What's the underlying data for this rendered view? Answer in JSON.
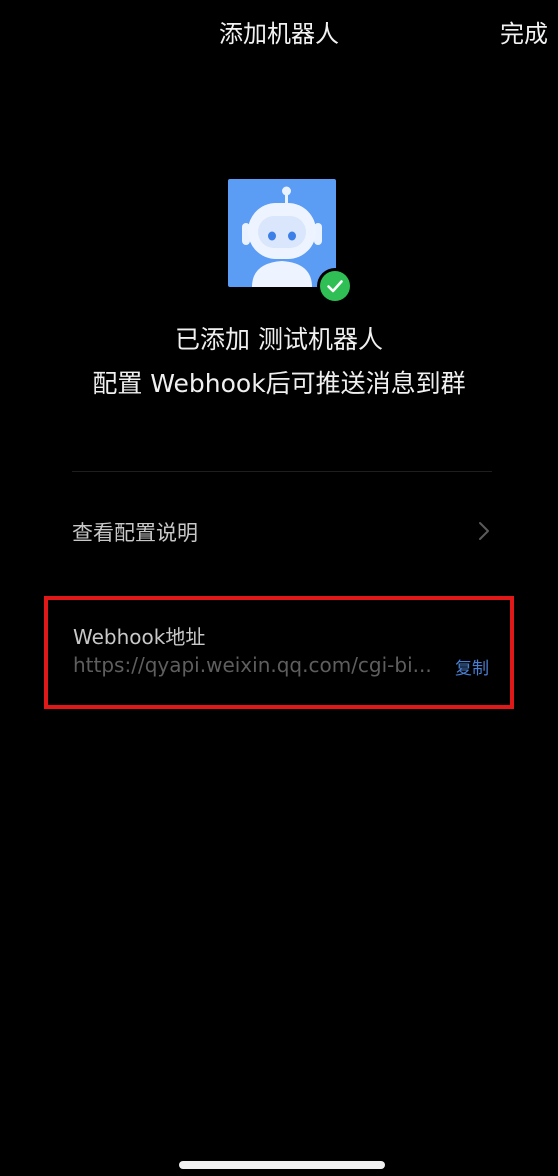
{
  "nav": {
    "title": "添加机器人",
    "done_label": "完成"
  },
  "robot": {
    "avatar_icon": "robot-icon",
    "badge_icon": "check-circle-icon",
    "avatar_color": "#5b9cf5",
    "badge_color": "#2fbf55"
  },
  "status": {
    "added_text": "已添加 测试机器人",
    "instruction_text": "配置 Webhook后可推送消息到群"
  },
  "config": {
    "label": "查看配置说明",
    "chevron_icon": "chevron-right-icon"
  },
  "webhook": {
    "label": "Webhook地址",
    "url": "https://qyapi.weixin.qq.com/cgi-bi...",
    "copy_label": "复制",
    "copy_color": "#4a7fd0"
  },
  "highlight": {
    "color": "#e01818"
  }
}
